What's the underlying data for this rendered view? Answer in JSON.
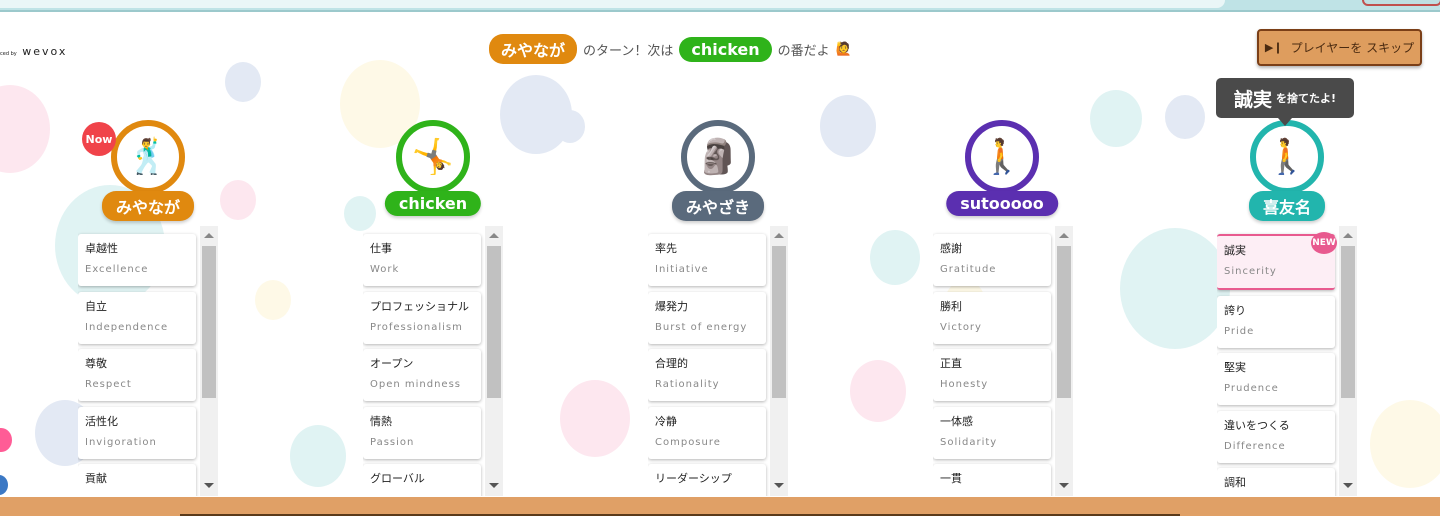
{
  "logo": {
    "prefix": "ced by",
    "name": "wevox"
  },
  "turn": {
    "current": "みやなが",
    "text1": "のターン！次は",
    "next": "chicken",
    "text2": "の番だよ",
    "emoji": "🙋"
  },
  "skip_button": {
    "icon": "skip-next-icon",
    "label": "プレイヤーを スキップ"
  },
  "discard_tooltip": {
    "value": "誠実",
    "text": "を捨てたよ!"
  },
  "now_badge": "Now",
  "new_badge": "NEW",
  "colors": {
    "orange": "#e0890f",
    "green": "#2fb31a",
    "slate": "#5a6a7c",
    "purple": "#5b2fb0",
    "teal": "#22b5ad"
  },
  "players": [
    {
      "name": "みやなが",
      "color": "#e0890f",
      "now": true,
      "cards": [
        {
          "ja": "卓越性",
          "en": "Excellence"
        },
        {
          "ja": "自立",
          "en": "Independence"
        },
        {
          "ja": "尊敬",
          "en": "Respect"
        },
        {
          "ja": "活性化",
          "en": "Invigoration"
        },
        {
          "ja": "貢献",
          "en": ""
        }
      ]
    },
    {
      "name": "chicken",
      "color": "#2fb31a",
      "now": false,
      "cards": [
        {
          "ja": "仕事",
          "en": "Work"
        },
        {
          "ja": "プロフェッショナル",
          "en": "Professionalism"
        },
        {
          "ja": "オープン",
          "en": "Open mindness"
        },
        {
          "ja": "情熱",
          "en": "Passion"
        },
        {
          "ja": "グローバル",
          "en": ""
        }
      ]
    },
    {
      "name": "みやざき",
      "color": "#5a6a7c",
      "now": false,
      "cards": [
        {
          "ja": "率先",
          "en": "Initiative"
        },
        {
          "ja": "爆発力",
          "en": "Burst of energy"
        },
        {
          "ja": "合理的",
          "en": "Rationality"
        },
        {
          "ja": "冷静",
          "en": "Composure"
        },
        {
          "ja": "リーダーシップ",
          "en": ""
        }
      ]
    },
    {
      "name": "sutooooo",
      "color": "#5b2fb0",
      "now": false,
      "cards": [
        {
          "ja": "感謝",
          "en": "Gratitude"
        },
        {
          "ja": "勝利",
          "en": "Victory"
        },
        {
          "ja": "正直",
          "en": "Honesty"
        },
        {
          "ja": "一体感",
          "en": "Solidarity"
        },
        {
          "ja": "一貫",
          "en": ""
        }
      ]
    },
    {
      "name": "喜友名",
      "color": "#22b5ad",
      "now": false,
      "cards": [
        {
          "ja": "誠実",
          "en": "Sincerity",
          "new": true
        },
        {
          "ja": "誇り",
          "en": "Pride"
        },
        {
          "ja": "堅実",
          "en": "Prudence"
        },
        {
          "ja": "違いをつくる",
          "en": "Difference"
        },
        {
          "ja": "調和",
          "en": ""
        }
      ]
    }
  ]
}
